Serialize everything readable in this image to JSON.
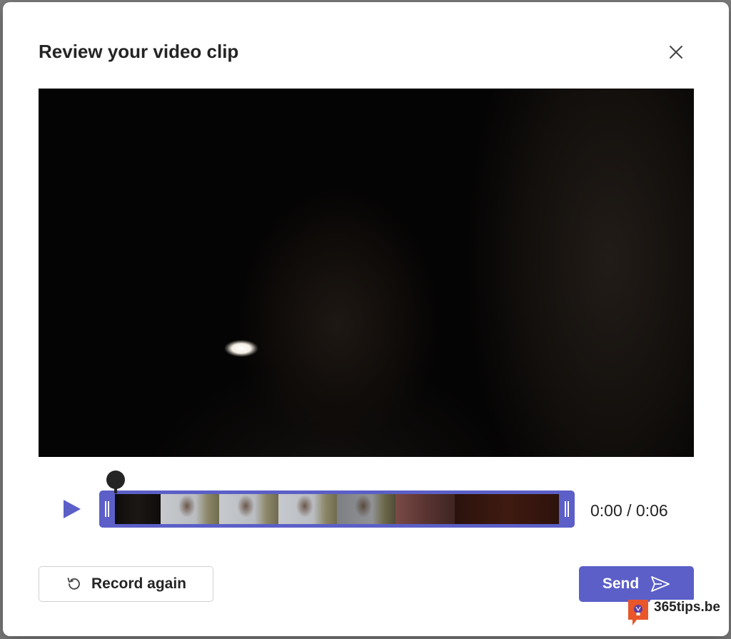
{
  "dialog": {
    "title": "Review your video clip",
    "close_icon": "close-icon"
  },
  "player": {
    "play_icon": "play-icon",
    "current_time": "0:00",
    "separator": "/",
    "duration": "0:06",
    "time_display": "0:00 / 0:06",
    "playhead_position": 0
  },
  "footer": {
    "record_again_label": "Record again",
    "record_again_icon": "rotate-ccw-icon",
    "send_label": "Send",
    "send_icon": "send-icon"
  },
  "watermark": {
    "name": "365tips.be",
    "logo_icon": "lightbulb-chat-icon"
  },
  "colors": {
    "accent": "#5b5fc7",
    "text": "#242424",
    "watermark_orange": "#e8562a"
  }
}
